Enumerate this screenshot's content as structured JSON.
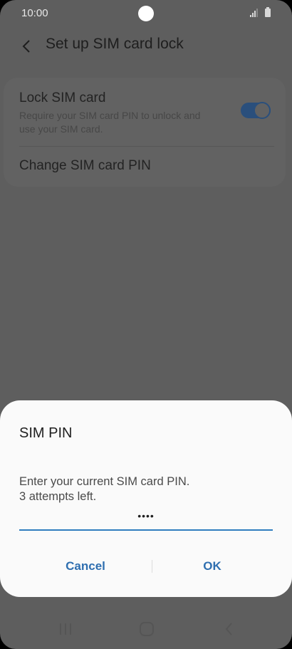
{
  "status_bar": {
    "time": "10:00"
  },
  "header": {
    "title": "Set up SIM card lock"
  },
  "settings": {
    "lock_sim": {
      "title": "Lock SIM card",
      "description": "Require your SIM card PIN to unlock and use your SIM card.",
      "enabled": true
    },
    "change_pin": {
      "title": "Change SIM card PIN"
    }
  },
  "dialog": {
    "title": "SIM PIN",
    "message_line1": "Enter your current SIM card PIN.",
    "message_line2": "3 attempts left.",
    "pin_value": "••••",
    "cancel_label": "Cancel",
    "ok_label": "OK"
  },
  "colors": {
    "accent": "#2f7dbf",
    "toggle_on": "#2a4f7c",
    "dim_background": "#5e5e5e"
  },
  "icons": {
    "back": "back-arrow-icon",
    "recents": "recents-icon",
    "home": "home-icon",
    "nav_back": "nav-back-icon"
  }
}
